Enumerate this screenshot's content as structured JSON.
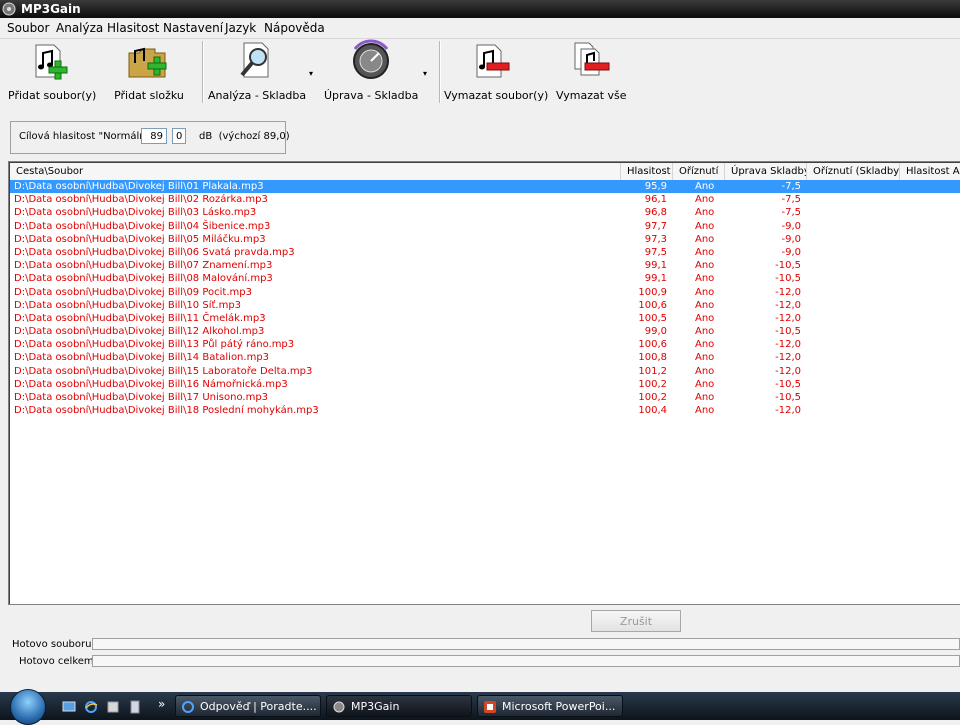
{
  "window": {
    "title": "MP3Gain"
  },
  "menu": [
    "Soubor",
    "Analýza",
    "Hlasitost",
    "Nastavení",
    "Jazyk",
    "Nápověda"
  ],
  "toolbar": {
    "add_file": "Přidat soubor(y)",
    "add_folder": "Přidat složku",
    "analysis": "Analýza - Skladba",
    "modify": "Úprava - Skladba",
    "remove_file": "Vymazat soubor(y)",
    "remove_all": "Vymazat vše",
    "dropdown_arrow": "▾"
  },
  "target": {
    "label": "Cílová hlasitost \"Normální\":",
    "int_value": "89",
    "decimal_separator": ",",
    "frac_value": "0",
    "unit": "dB",
    "default_text": "(výchozí 89,0)"
  },
  "table": {
    "columns": [
      "Cesta\\Soubor",
      "Hlasitost",
      "Oříznutí",
      "Úprava Skladby",
      "Oříznutí (Skladby)",
      "Hlasitost Al"
    ],
    "rows": [
      [
        "D:\\Data osobní\\Hudba\\Divokej Bill\\01 Plakala.mp3",
        "95,9",
        "Ano",
        "-7,5"
      ],
      [
        "D:\\Data osobní\\Hudba\\Divokej Bill\\02 Rozárka.mp3",
        "96,1",
        "Ano",
        "-7,5"
      ],
      [
        "D:\\Data osobní\\Hudba\\Divokej Bill\\03 Lásko.mp3",
        "96,8",
        "Ano",
        "-7,5"
      ],
      [
        "D:\\Data osobní\\Hudba\\Divokej Bill\\04 Šibenice.mp3",
        "97,7",
        "Ano",
        "-9,0"
      ],
      [
        "D:\\Data osobní\\Hudba\\Divokej Bill\\05 Miláčku.mp3",
        "97,3",
        "Ano",
        "-9,0"
      ],
      [
        "D:\\Data osobní\\Hudba\\Divokej Bill\\06 Svatá pravda.mp3",
        "97,5",
        "Ano",
        "-9,0"
      ],
      [
        "D:\\Data osobní\\Hudba\\Divokej Bill\\07 Znamení.mp3",
        "99,1",
        "Ano",
        "-10,5"
      ],
      [
        "D:\\Data osobní\\Hudba\\Divokej Bill\\08 Malování.mp3",
        "99,1",
        "Ano",
        "-10,5"
      ],
      [
        "D:\\Data osobní\\Hudba\\Divokej Bill\\09 Pocit.mp3",
        "100,9",
        "Ano",
        "-12,0"
      ],
      [
        "D:\\Data osobní\\Hudba\\Divokej Bill\\10 Síť.mp3",
        "100,6",
        "Ano",
        "-12,0"
      ],
      [
        "D:\\Data osobní\\Hudba\\Divokej Bill\\11 Čmelák.mp3",
        "100,5",
        "Ano",
        "-12,0"
      ],
      [
        "D:\\Data osobní\\Hudba\\Divokej Bill\\12 Alkohol.mp3",
        "99,0",
        "Ano",
        "-10,5"
      ],
      [
        "D:\\Data osobní\\Hudba\\Divokej Bill\\13 Půl pátý ráno.mp3",
        "100,6",
        "Ano",
        "-12,0"
      ],
      [
        "D:\\Data osobní\\Hudba\\Divokej Bill\\14 Batalion.mp3",
        "100,8",
        "Ano",
        "-12,0"
      ],
      [
        "D:\\Data osobní\\Hudba\\Divokej Bill\\15 Laboratoře Delta.mp3",
        "101,2",
        "Ano",
        "-12,0"
      ],
      [
        "D:\\Data osobní\\Hudba\\Divokej Bill\\16 Námořnická.mp3",
        "100,2",
        "Ano",
        "-10,5"
      ],
      [
        "D:\\Data osobní\\Hudba\\Divokej Bill\\17 Unisono.mp3",
        "100,2",
        "Ano",
        "-10,5"
      ],
      [
        "D:\\Data osobní\\Hudba\\Divokej Bill\\18 Poslední mohykán.mp3",
        "100,4",
        "Ano",
        "-12,0"
      ]
    ],
    "selected_row": 0
  },
  "cancel_label": "Zrušit",
  "progress": {
    "file_label": "Hotovo souboru",
    "file_value": 0,
    "total_label": "Hotovo celkem",
    "total_value": 0
  },
  "taskbar": {
    "more_glyph": "»",
    "tasks": [
      "Odpověď | Poradte....",
      "MP3Gain",
      "Microsoft PowerPoi..."
    ],
    "active_task": 1
  },
  "colors": {
    "row_text": "#e00000",
    "selection": "#3399ff"
  }
}
